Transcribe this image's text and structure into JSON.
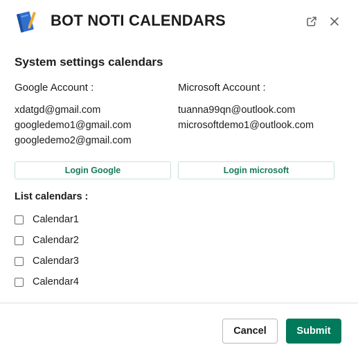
{
  "header": {
    "title": "BOT NOTI CALENDARS",
    "logo_icon": "notebook-icon",
    "popout_icon": "external-link-icon",
    "close_icon": "close-icon"
  },
  "settings": {
    "section_title": "System settings calendars",
    "google": {
      "label": "Google Account :",
      "accounts": [
        "xdatgd@gmail.com",
        "googledemo1@gmail.com",
        "googledemo2@gmail.com"
      ],
      "login_label": "Login Google"
    },
    "microsoft": {
      "label": "Microsoft Account :",
      "accounts": [
        "tuanna99qn@outlook.com",
        "microsoftdemo1@outlook.com"
      ],
      "login_label": "Login microsoft"
    }
  },
  "calendars": {
    "title": "List calendars :",
    "items": [
      {
        "label": "Calendar1",
        "checked": false
      },
      {
        "label": "Calendar2",
        "checked": false
      },
      {
        "label": "Calendar3",
        "checked": false
      },
      {
        "label": "Calendar4",
        "checked": false
      }
    ]
  },
  "footer": {
    "cancel_label": "Cancel",
    "submit_label": "Submit"
  },
  "colors": {
    "primary": "#007a5a",
    "link_green": "#1a7a5e",
    "text": "#1d1c1d",
    "logo_blue": "#2f6fcf",
    "logo_orange": "#f0a830"
  }
}
